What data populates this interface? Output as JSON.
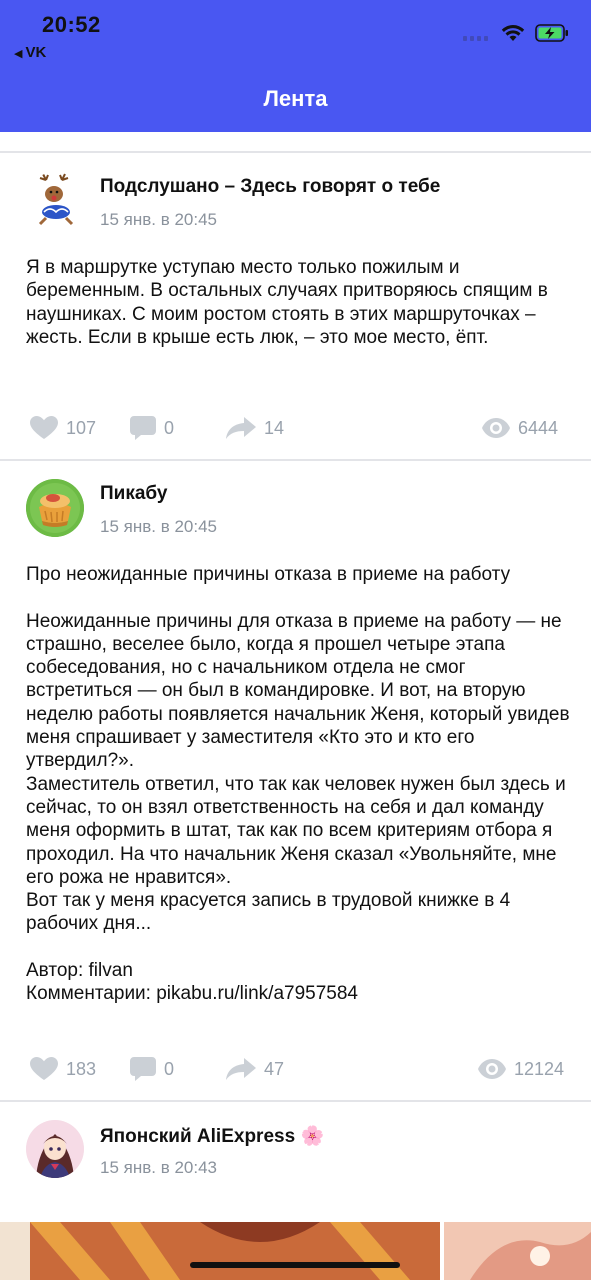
{
  "status_bar": {
    "time": "20:52",
    "back_app": "VK",
    "battery_state": "charging"
  },
  "header": {
    "title": "Лента",
    "background": "#4957f2"
  },
  "posts": [
    {
      "author": "Подслушано – Здесь говорят о тебе",
      "date": "15 янв. в 20:45",
      "avatar_icon": "reindeer-icon",
      "text": "Я в маршрутке уступаю место только пожилым и беременным. В остальных случаях притворяюсь спящим в наушниках. С моим ростом стоять в этих маршруточках – жесть. Если в крыше есть люк, – это мое место, ёпт.",
      "likes": "107",
      "comments": "0",
      "shares": "14",
      "views": "6444"
    },
    {
      "author": "Пикабу",
      "date": "15 янв. в 20:45",
      "avatar_icon": "pikabu-logo-icon",
      "text": "Про неожиданные причины отказа в приеме на работу\n\nНеожиданные причины для отказа в приеме на работу — не страшно, веселее было, когда я прошел четыре этапа собеседования, но с начальником отдела не смог встретиться — он был в командировке. И вот, на вторую неделю работы появляется начальник Женя, который увидев меня спрашивает у заместителя «Кто это и кто его утвердил?».\nЗаместитель ответил, что так как человек нужен был здесь и сейчас, то он взял ответственность на себя и дал команду меня оформить в штат, так как по всем критериям отбора я проходил. На что начальник Женя сказал «Увольняйте, мне его рожа не нравится».\nВот так у меня красуется запись в трудовой книжке в 4 рабочих дня...\n\nАвтор: filvan\nКомментарии: pikabu.ru/link/a7957584",
      "likes": "183",
      "comments": "0",
      "shares": "47",
      "views": "12124"
    },
    {
      "author": "Японский AliExpress",
      "author_emoji": "🌸",
      "date": "15 янв. в 20:43",
      "avatar_icon": "anime-girl-avatar-icon"
    }
  ],
  "colors": {
    "accent": "#4957f2",
    "meta_text": "#8a929c",
    "action_gray": "#99a2ad",
    "divider": "#e3e4e8"
  }
}
